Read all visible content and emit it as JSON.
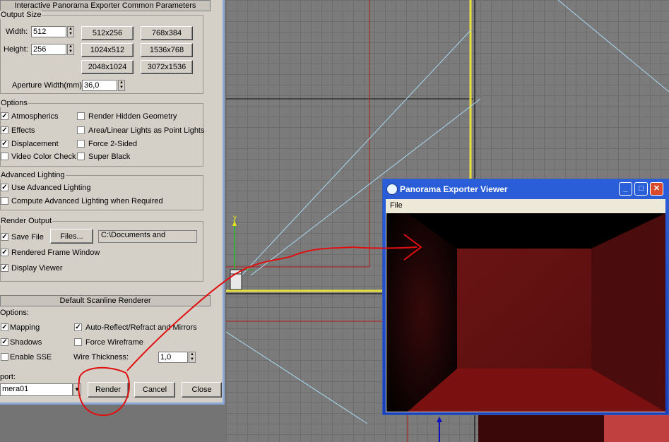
{
  "panel": {
    "title": "Interactive Panorama Exporter Common Parameters",
    "output_size": {
      "group_label": "Output Size",
      "width_label": "Width:",
      "width_value": "512",
      "height_label": "Height:",
      "height_value": "256",
      "presets": [
        "512x256",
        "768x384",
        "1024x512",
        "1536x768",
        "2048x1024",
        "3072x1536"
      ],
      "aperture_label": "Aperture Width(mm):",
      "aperture_value": "36,0"
    },
    "options": {
      "group_label": "Options",
      "items": [
        {
          "label": "Atmospherics",
          "checked": true
        },
        {
          "label": "Render Hidden Geometry",
          "checked": false
        },
        {
          "label": "Effects",
          "checked": true
        },
        {
          "label": "Area/Linear Lights as Point Lights",
          "checked": false
        },
        {
          "label": "Displacement",
          "checked": true
        },
        {
          "label": "Force 2-Sided",
          "checked": false
        },
        {
          "label": "Video Color Check",
          "checked": false
        },
        {
          "label": "Super Black",
          "checked": false
        }
      ]
    },
    "advanced_lighting": {
      "group_label": "Advanced Lighting",
      "use_label": "Use Advanced Lighting",
      "use_checked": true,
      "compute_label": "Compute Advanced Lighting when Required",
      "compute_checked": false
    },
    "render_output": {
      "group_label": "Render Output",
      "save_file_label": "Save File",
      "save_file_checked": true,
      "files_button": "Files...",
      "path_text": "C:\\Documents and",
      "rendered_frame_label": "Rendered Frame Window",
      "rendered_frame_checked": true,
      "display_viewer_label": "Display Viewer",
      "display_viewer_checked": true
    }
  },
  "renderer": {
    "title": "Default Scanline Renderer",
    "options_label": "Options:",
    "mapping_label": "Mapping",
    "mapping_checked": true,
    "auto_reflect_label": "Auto-Reflect/Refract and Mirrors",
    "auto_reflect_checked": true,
    "shadows_label": "Shadows",
    "shadows_checked": true,
    "force_wireframe_label": "Force Wireframe",
    "force_wireframe_checked": false,
    "enable_sse_label": "Enable SSE",
    "enable_sse_checked": false,
    "wire_thickness_label": "Wire Thickness:",
    "wire_thickness_value": "1,0"
  },
  "bottom": {
    "viewport_label": "port:",
    "viewport_value": "mera01",
    "render_button": "Render",
    "cancel_button": "Cancel",
    "close_button": "Close"
  },
  "viewer": {
    "title": "Panorama Exporter Viewer",
    "menu_file": "File"
  },
  "colors": {
    "dialog_bg": "#d4d0c8",
    "viewport_bg": "#7b7b7b",
    "annotation_red": "#e01010",
    "xp_title_blue": "#1f4fd0",
    "room_red": "#7a1010"
  },
  "axis_label": "y"
}
